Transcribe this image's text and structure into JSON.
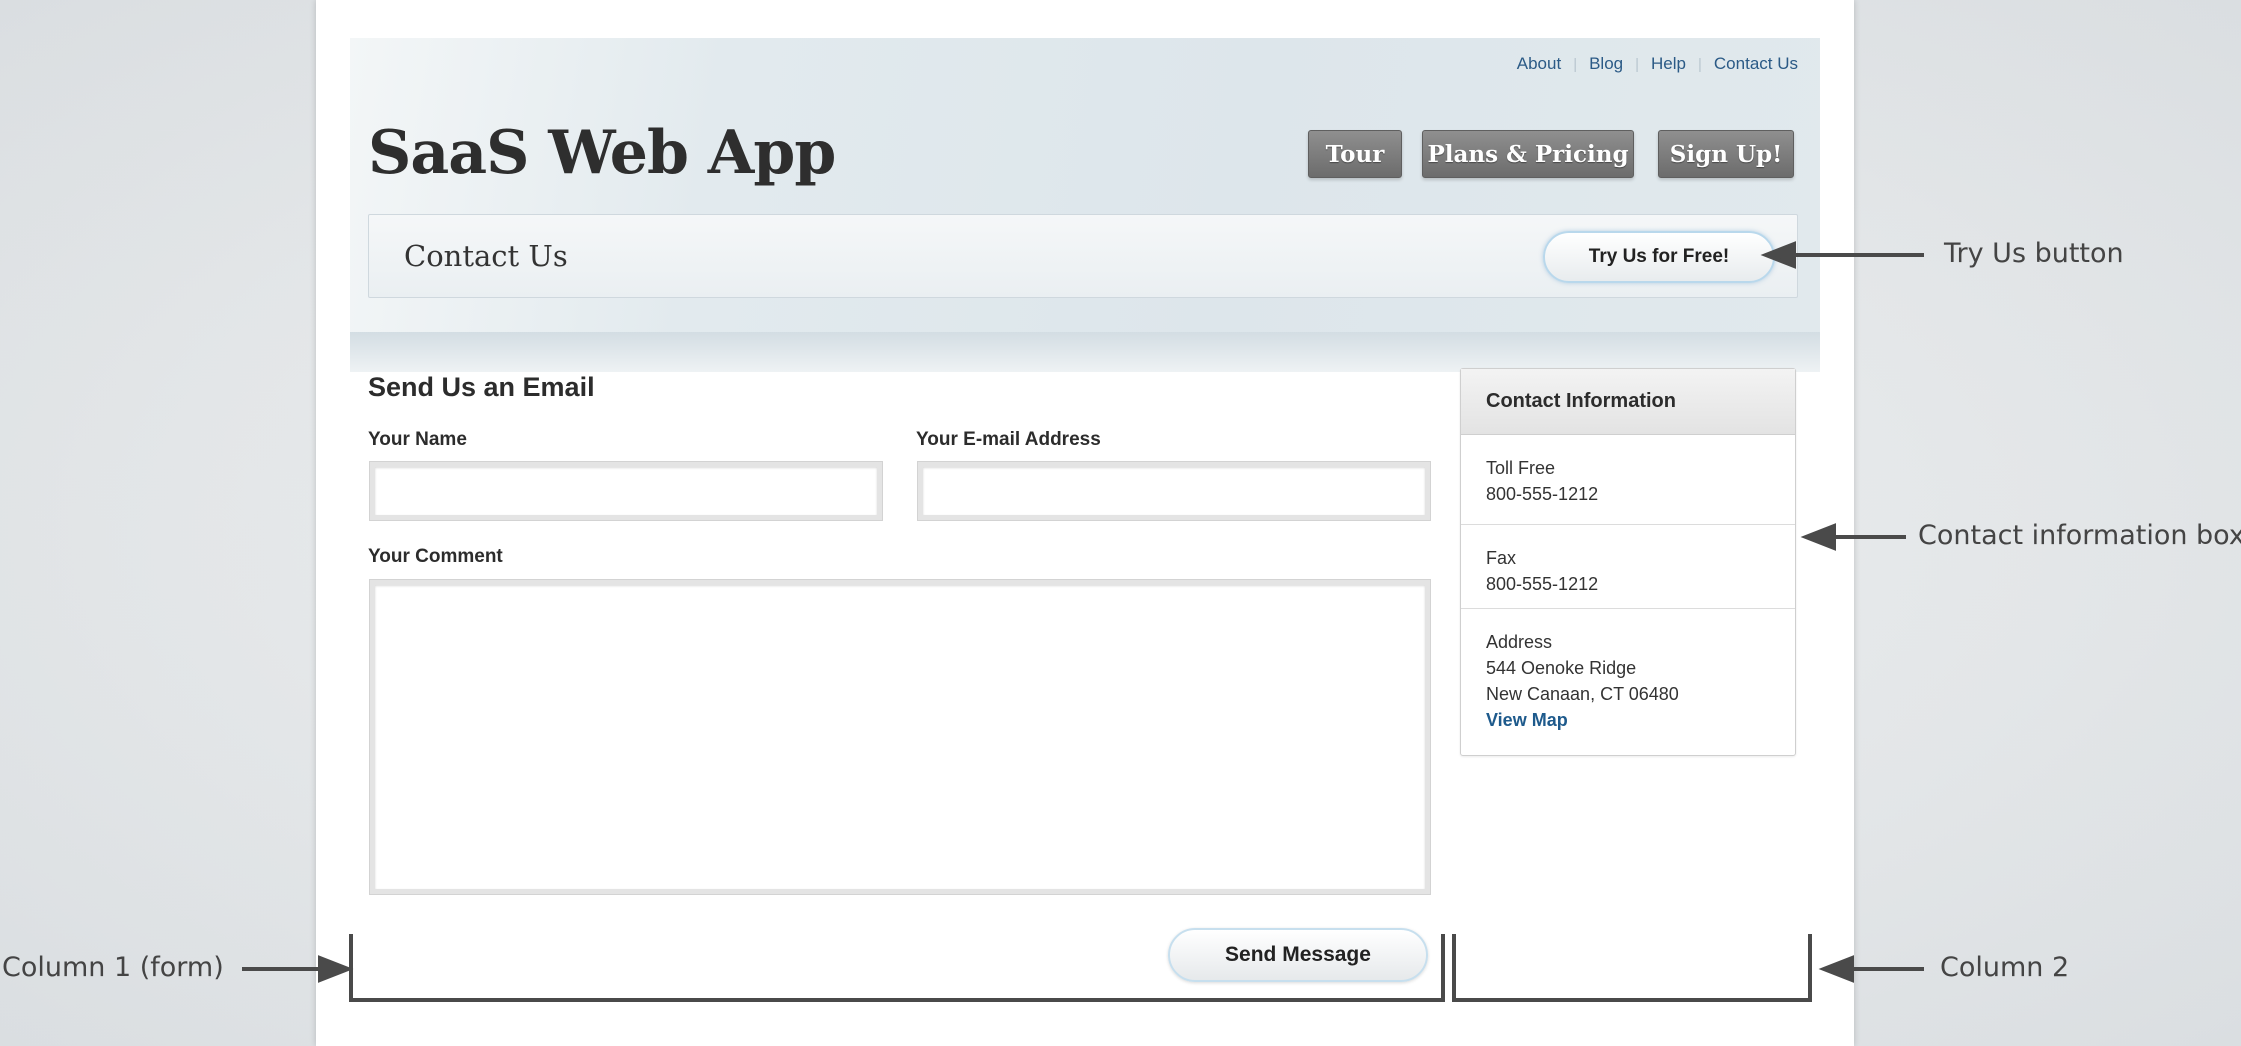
{
  "header": {
    "top_links": [
      "About",
      "Blog",
      "Help",
      "Contact Us"
    ],
    "logo": "SaaS Web App",
    "nav": {
      "tour": "Tour",
      "plans": "Plans & Pricing",
      "signup": "Sign Up!"
    }
  },
  "title_bar": {
    "title": "Contact Us",
    "try_button": "Try Us for Free!"
  },
  "form": {
    "heading": "Send Us an Email",
    "name_label": "Your Name",
    "name_value": "",
    "email_label": "Your E-mail Address",
    "email_value": "",
    "comment_label": "Your Comment",
    "comment_value": "",
    "send_button": "Send Message"
  },
  "contact": {
    "heading": "Contact Information",
    "toll_free_label": "Toll Free",
    "toll_free_value": "800-555-1212",
    "fax_label": "Fax",
    "fax_value": "800-555-1212",
    "address_label": "Address",
    "address_line1": "544 Oenoke Ridge",
    "address_line2": "New Canaan, CT 06480",
    "map_link": "View Map"
  },
  "annotations": {
    "try_us": "Try Us button",
    "contact_box": "Contact information box",
    "column1": "Column 1 (form)",
    "column2": "Column 2"
  }
}
